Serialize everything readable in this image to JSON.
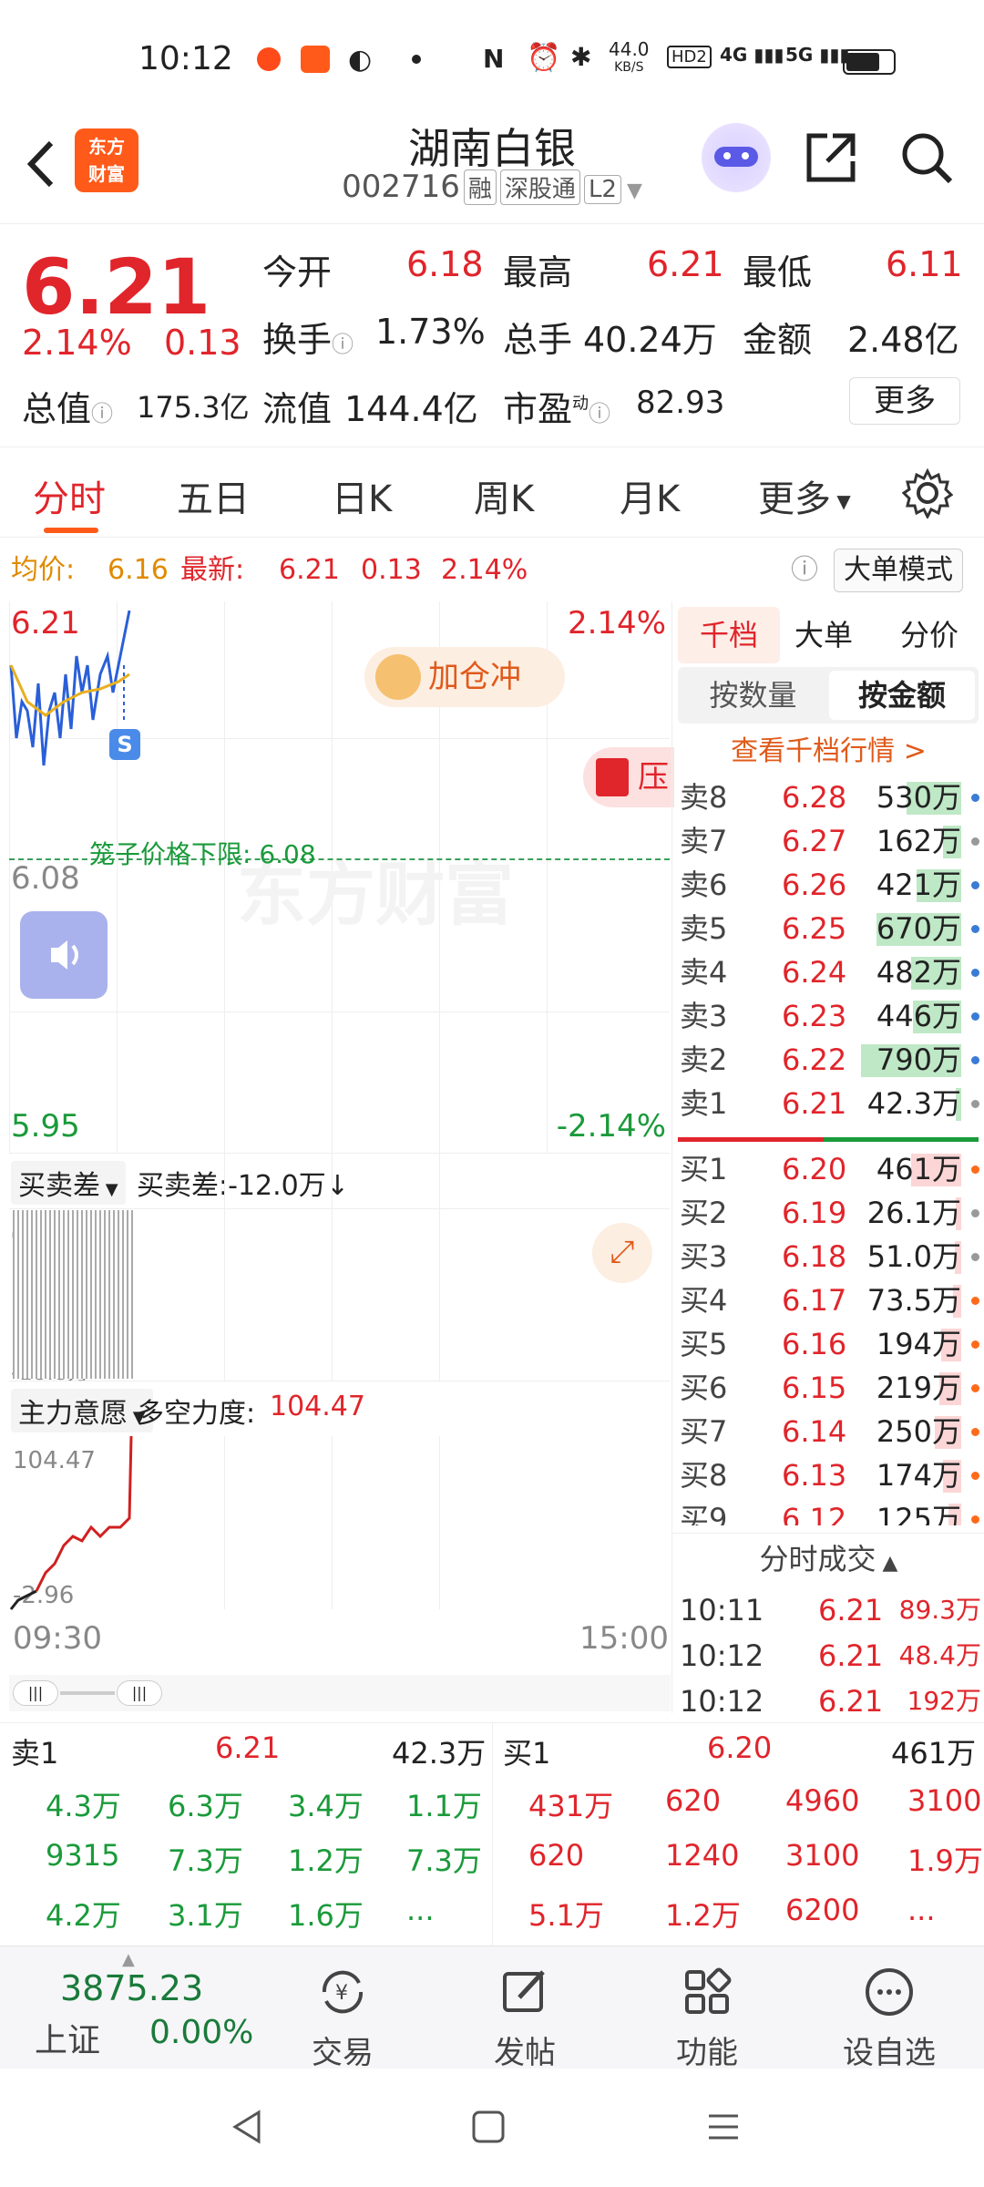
{
  "status": {
    "time": "10:12",
    "net_speed": "44.0",
    "net_unit": "KB/S",
    "sig1": "4G",
    "sig2": "5G",
    "hd": "HD2"
  },
  "header": {
    "title": "湖南白银",
    "code": "002716",
    "tags": [
      "融",
      "深股通",
      "L2"
    ],
    "logo_line1": "东方",
    "logo_line2": "财富"
  },
  "quote": {
    "price": "6.21",
    "pct": "2.14%",
    "chg": "0.13",
    "open_label": "今开",
    "open": "6.18",
    "high_label": "最高",
    "high": "6.21",
    "low_label": "最低",
    "low": "6.11",
    "turnover_label": "换手",
    "turnover": "1.73%",
    "volume_label": "总手",
    "volume": "40.24万",
    "amount_label": "金额",
    "amount": "2.48亿",
    "mktcap_label": "总值",
    "mktcap": "175.3亿",
    "float_label": "流值",
    "float": "144.4亿",
    "pe_label": "市盈",
    "pe_sup": "动",
    "pe": "82.93",
    "more": "更多"
  },
  "tabs": [
    "分时",
    "五日",
    "日K",
    "周K",
    "月K",
    "更多"
  ],
  "infobar": {
    "avg_label": "均价:",
    "avg": "6.16",
    "latest_label": "最新:",
    "latest": "6.21",
    "chg": "0.13",
    "pct": "2.14%",
    "mode": "大单模式"
  },
  "chart": {
    "top_price": "6.21",
    "top_pct": "2.14%",
    "mid_price": "6.08",
    "bottom_price": "5.95",
    "bottom_pct": "-2.14%",
    "cage_label": "笼子价格下限: 6.08",
    "promo": "加仓冲",
    "promo2": "压",
    "s_badge": "S",
    "watermark": "东方财富",
    "sub1_label": "买卖差",
    "sub1_value": "买卖差:-12.0万↓",
    "sub1_zero": "0",
    "sub1_min": "-18.8万",
    "sub2_label": "主力意愿",
    "sub2_value_label": "多空力度:",
    "sub2_value": "104.47",
    "sub2_max": "104.47",
    "sub2_min": "-2.96",
    "time_start": "09:30",
    "time_end": "15:00"
  },
  "book": {
    "tabs": [
      "千档",
      "大单",
      "分价"
    ],
    "modes": [
      "按数量",
      "按金额"
    ],
    "link": "查看千档行情 >",
    "asks": [
      {
        "label": "卖8",
        "price": "6.28",
        "vol": "530万",
        "dot": "#3a7bd5",
        "bar": 0.55
      },
      {
        "label": "卖7",
        "price": "6.27",
        "vol": "162万",
        "dot": "#999999",
        "bar": 0.18
      },
      {
        "label": "卖6",
        "price": "6.26",
        "vol": "421万",
        "dot": "#3a7bd5",
        "bar": 0.45
      },
      {
        "label": "卖5",
        "price": "6.25",
        "vol": "670万",
        "dot": "#3a7bd5",
        "bar": 0.85
      },
      {
        "label": "卖4",
        "price": "6.24",
        "vol": "482万",
        "dot": "#3a7bd5",
        "bar": 0.5
      },
      {
        "label": "卖3",
        "price": "6.23",
        "vol": "446万",
        "dot": "#3a7bd5",
        "bar": 0.48
      },
      {
        "label": "卖2",
        "price": "6.22",
        "vol": "790万",
        "dot": "#3a7bd5",
        "bar": 1.0
      },
      {
        "label": "卖1",
        "price": "6.21",
        "vol": "42.3万",
        "dot": "#999999",
        "bar": 0.05
      }
    ],
    "bids": [
      {
        "label": "买1",
        "price": "6.20",
        "vol": "461万",
        "dot": "#ff6a1a",
        "bar": 0.5
      },
      {
        "label": "买2",
        "price": "6.19",
        "vol": "26.1万",
        "dot": "#999999",
        "bar": 0.03
      },
      {
        "label": "买3",
        "price": "6.18",
        "vol": "51.0万",
        "dot": "#999999",
        "bar": 0.06
      },
      {
        "label": "买4",
        "price": "6.17",
        "vol": "73.5万",
        "dot": "#ff6a1a",
        "bar": 0.08
      },
      {
        "label": "买5",
        "price": "6.16",
        "vol": "194万",
        "dot": "#ff6a1a",
        "bar": 0.2
      },
      {
        "label": "买6",
        "price": "6.15",
        "vol": "219万",
        "dot": "#ff6a1a",
        "bar": 0.22
      },
      {
        "label": "买7",
        "price": "6.14",
        "vol": "250万",
        "dot": "#ff6a1a",
        "bar": 0.26
      },
      {
        "label": "买8",
        "price": "6.13",
        "vol": "174万",
        "dot": "#ff6a1a",
        "bar": 0.18
      },
      {
        "label": "买9",
        "price": "6.12",
        "vol": "125万",
        "dot": "#ff6a1a",
        "bar": 0.13
      }
    ],
    "trades_title": "分时成交",
    "trades": [
      {
        "time": "10:11",
        "price": "6.21",
        "vol": "89.3万"
      },
      {
        "time": "10:12",
        "price": "6.21",
        "vol": "48.4万"
      },
      {
        "time": "10:12",
        "price": "6.21",
        "vol": "192万"
      }
    ]
  },
  "quick": {
    "sell_label": "卖1",
    "sell_price": "6.21",
    "sell_vol": "42.3万",
    "buy_label": "买1",
    "buy_price": "6.20",
    "buy_vol": "461万",
    "sell_cells": [
      "4.3万",
      "6.3万",
      "3.4万",
      "1.1万",
      "9315",
      "7.3万",
      "1.2万",
      "7.3万",
      "4.2万",
      "3.1万",
      "1.6万",
      "..."
    ],
    "buy_cells": [
      "431万",
      "620",
      "4960",
      "3100",
      "620",
      "1240",
      "3100",
      "1.9万",
      "5.1万",
      "1.2万",
      "6200",
      "..."
    ]
  },
  "tabbar": {
    "index_value": "3875.23",
    "index_name": "上证",
    "index_pct": "0.00%",
    "items": [
      "交易",
      "发帖",
      "功能",
      "设自选"
    ]
  }
}
